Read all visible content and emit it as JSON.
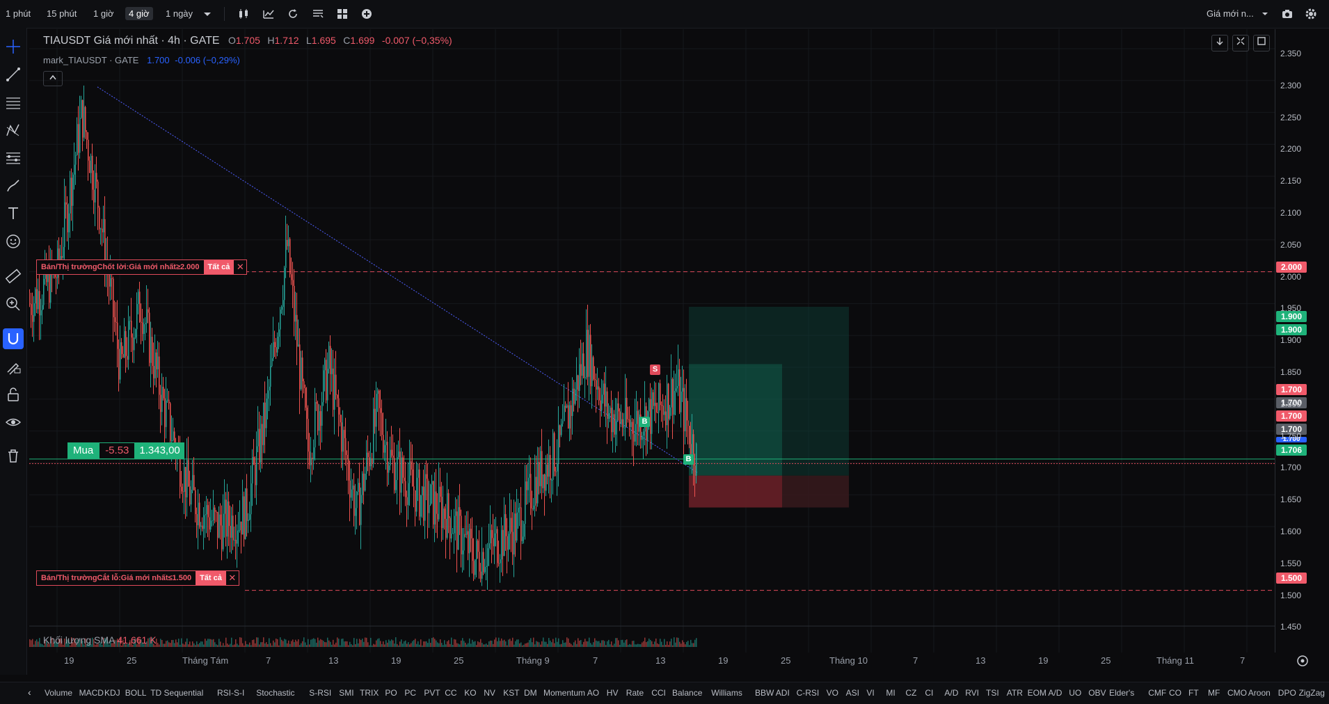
{
  "toolbar": {
    "intervals": [
      "1 phút",
      "15 phút",
      "1 giờ",
      "4 giờ",
      "1 ngày"
    ],
    "active_interval": "4 giờ",
    "price_source": "Giá mới n..."
  },
  "legend": {
    "title": "TIAUSDT Giá mới nhất · 4h · GATE",
    "o_label": "O",
    "o": "1.705",
    "h_label": "H",
    "h": "1.712",
    "l_label": "L",
    "l": "1.695",
    "c_label": "C",
    "c": "1.699",
    "change": "-0.007 (−0,35%)",
    "mark_name": "mark_TIAUSDT · GATE",
    "mark_price": "1.700",
    "mark_change": "-0.006 (−0,29%)"
  },
  "orders": {
    "tp_text": "Bán/Thị trườngChốt lời:Giá mới nhất≥2.000",
    "sl_text": "Bán/Thị trườngCắt lỗ:Giá mới nhất≤1.500",
    "all_label": "Tất cả"
  },
  "position": {
    "side": "Mua",
    "pnl": "-5.53",
    "size": "1.343,00"
  },
  "markers": {
    "buy": "B",
    "sell": "S"
  },
  "price_axis": [
    "2.350",
    "2.300",
    "2.250",
    "2.200",
    "2.150",
    "2.100",
    "2.050",
    "2.000",
    "1.950",
    "1.900",
    "1.850",
    "1.800",
    "1.750",
    "1.700",
    "1.650",
    "1.600",
    "1.550",
    "1.500",
    "1.450"
  ],
  "price_tags": {
    "tp": "2.000",
    "g1": "1.900",
    "g2": "1.900",
    "r1": "1.700",
    "k1": "1.700",
    "r2": "1.700",
    "k2": "1.700",
    "b1": "1.700",
    "last": "1.706",
    "sl": "1.500"
  },
  "time_axis": [
    "19",
    "25",
    "Tháng Tám",
    "7",
    "13",
    "19",
    "25",
    "Tháng 9",
    "7",
    "13",
    "19",
    "25",
    "Tháng 10",
    "7",
    "13",
    "19",
    "25",
    "Tháng 11",
    "7"
  ],
  "volume_legend": {
    "label": "Khối lượng SMA",
    "value": "41,661 K"
  },
  "indicators": [
    "Volume",
    "MACD",
    "KDJ",
    "BOLL",
    "TD Sequential",
    "RSI-S-I",
    "Stochastic",
    "S-RSI",
    "SMI",
    "TRIX",
    "PO",
    "PC",
    "PVT",
    "CC",
    "KO",
    "NV",
    "KST",
    "DM",
    "Momentum",
    "AO",
    "HV",
    "Rate",
    "CCI",
    "Balance",
    "Williams",
    "BBW",
    "ADI",
    "C-RSI",
    "VO",
    "ASI",
    "VI",
    "MI",
    "CZ",
    "CI",
    "A/D",
    "RVI",
    "TSI",
    "ATR",
    "EOM",
    "A/D",
    "UO",
    "OBV",
    "Elder's",
    "CMF",
    "CO",
    "FT",
    "MF",
    "CMO",
    "Aroon",
    "DPO",
    "ZigZag"
  ],
  "colors": {
    "up": "#26a69a",
    "down": "#ef5350",
    "accent": "#2962ff",
    "background": "#0b0b0d"
  }
}
